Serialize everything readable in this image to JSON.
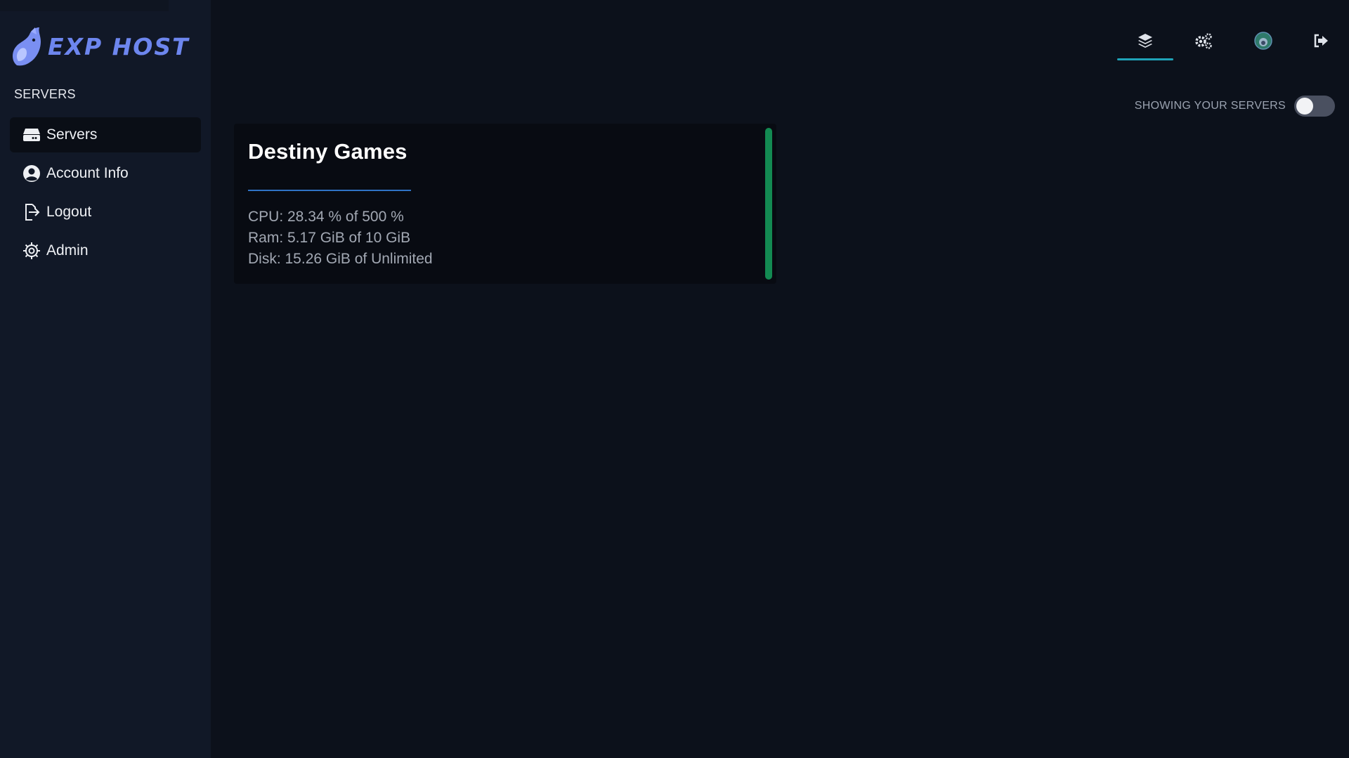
{
  "brand": {
    "name": "EXP HOST",
    "color": "#6d86ee"
  },
  "sidebar": {
    "section_title": "SERVERS",
    "items": [
      {
        "label": "Servers",
        "icon": "server-icon",
        "active": true
      },
      {
        "label": "Account Info",
        "icon": "user-circle-icon",
        "active": false
      },
      {
        "label": "Logout",
        "icon": "logout-icon",
        "active": false
      },
      {
        "label": "Admin",
        "icon": "gear-icon",
        "active": false
      }
    ]
  },
  "topnav": {
    "items": [
      {
        "icon": "layers-icon",
        "active": true
      },
      {
        "icon": "cogs-icon",
        "active": false
      },
      {
        "icon": "avatar-icon",
        "active": false
      },
      {
        "icon": "sign-out-icon",
        "active": false
      }
    ],
    "active_color": "#1fa3b8"
  },
  "toggle": {
    "label": "SHOWING YOUR SERVERS",
    "on": false
  },
  "server": {
    "name": "Destiny Games",
    "cpu": "CPU: 28.34 % of 500 %",
    "ram": "Ram: 5.17 GiB of 10 GiB",
    "disk": "Disk: 15.26 GiB of Unlimited",
    "status_color": "#138a52"
  }
}
